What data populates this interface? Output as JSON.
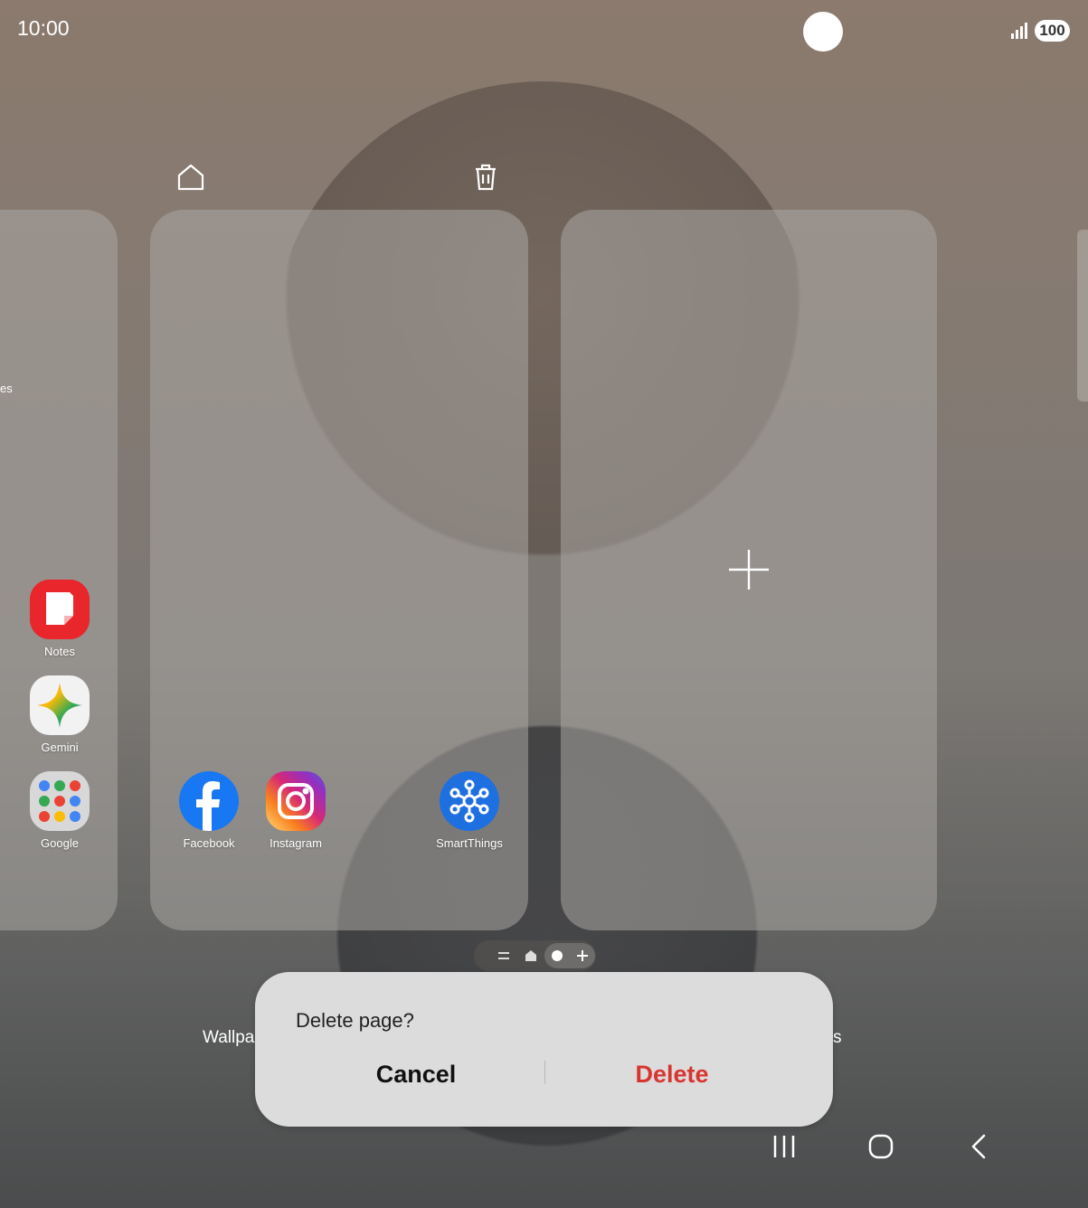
{
  "status_bar": {
    "time": "10:00",
    "battery": "100"
  },
  "edit": {
    "home_icon": "home-icon",
    "trash_icon": "trash-icon"
  },
  "left_page": {
    "edge_text": "es",
    "apps": [
      {
        "label": "Notes",
        "icon": "notes-icon",
        "color": "#e02a2a"
      },
      {
        "label": "Gemini",
        "icon": "gemini-icon",
        "color": "#f2f2f2"
      },
      {
        "label": "Google",
        "icon": "google-folder-icon",
        "color": "#d8d8d8"
      }
    ]
  },
  "center_page": {
    "apps": [
      {
        "label": "Facebook",
        "icon": "facebook-icon",
        "color": "#1877f2"
      },
      {
        "label": "Instagram",
        "icon": "instagram-icon",
        "color": "#d62976"
      },
      {
        "label": "SmartThings",
        "icon": "smartthings-icon",
        "color": "#1e6fe0"
      }
    ]
  },
  "right_page": {
    "add_icon": "plus-icon"
  },
  "background_labels": {
    "left": "Wallpa",
    "right": "s"
  },
  "dialog": {
    "title": "Delete page?",
    "cancel_label": "Cancel",
    "delete_label": "Delete",
    "delete_color": "#d8352f"
  },
  "nav": {
    "recents": "recents-icon",
    "home": "home-nav-icon",
    "back": "back-icon"
  }
}
